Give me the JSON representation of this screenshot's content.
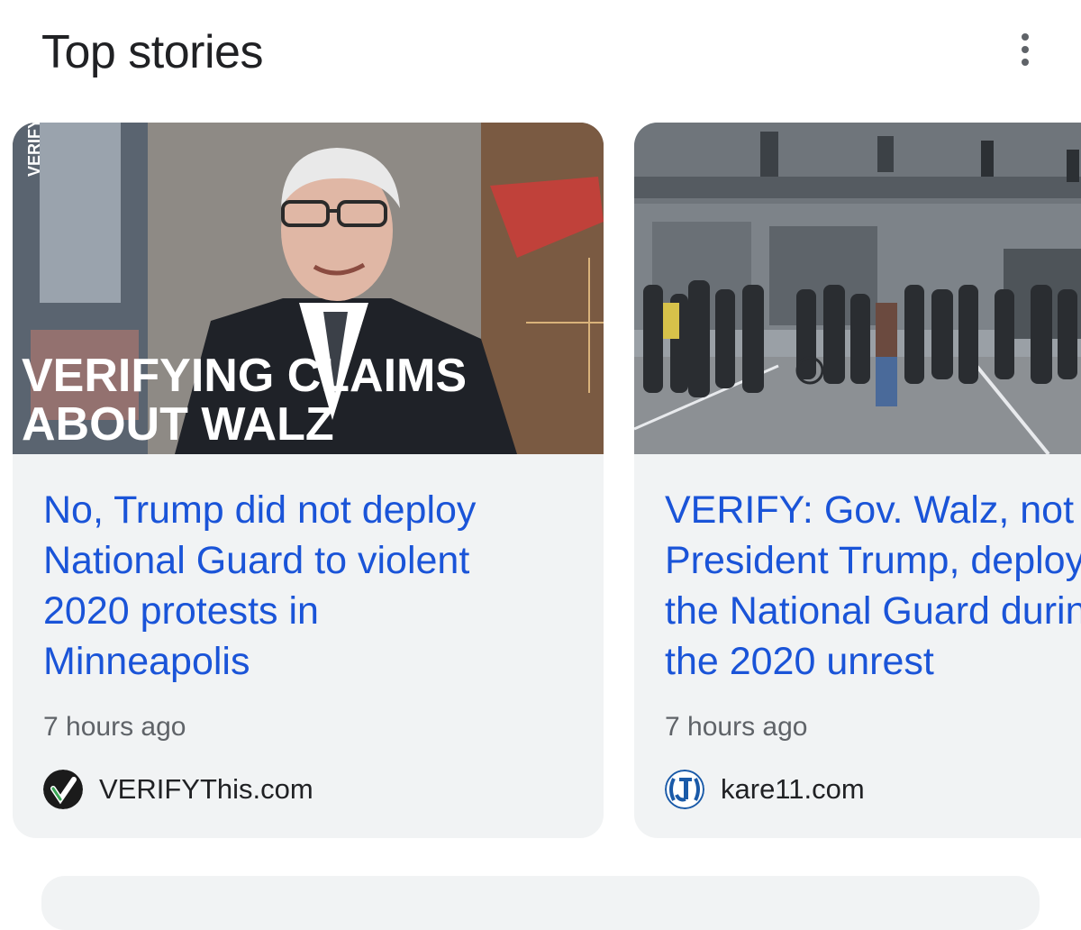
{
  "section": {
    "title": "Top stories",
    "more_icon": "more-vert-icon"
  },
  "stories": [
    {
      "thumb_caption_line1": "VERIFYING CLAIMS",
      "thumb_caption_line2": "ABOUT WALZ",
      "thumb_watermark": "VERIFY",
      "headline": "No, Trump did not deploy\nNational Guard to violent\n2020 protests in\nMinneapolis",
      "time": "7 hours ago",
      "source": "VERIFYThis.com",
      "favicon": "verify-check-icon"
    },
    {
      "headline": "VERIFY: Gov. Walz, not\nPresident Trump, deployed\nthe National Guard during\nthe 2020 unrest",
      "time": "7 hours ago",
      "source": "kare11.com",
      "favicon": "kare11-logo-icon"
    }
  ],
  "colors": {
    "headline_link": "#1a54d8",
    "card_bg": "#f1f3f4",
    "meta_text": "#5f6368"
  }
}
